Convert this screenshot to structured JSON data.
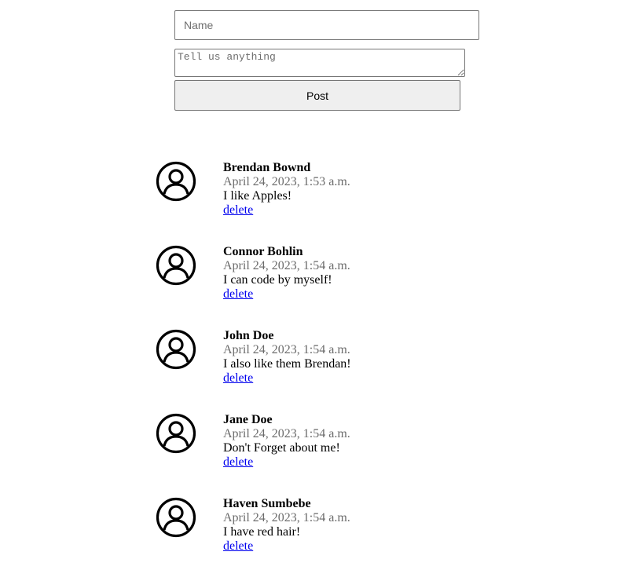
{
  "form": {
    "name_placeholder": "Name",
    "message_placeholder": "Tell us anything",
    "post_label": "Post"
  },
  "posts": [
    {
      "author": "Brendan Bownd",
      "date": "April 24, 2023, 1:53 a.m.",
      "message": "I like Apples!",
      "delete_label": "delete"
    },
    {
      "author": "Connor Bohlin",
      "date": "April 24, 2023, 1:54 a.m.",
      "message": "I can code by myself!",
      "delete_label": "delete"
    },
    {
      "author": "John Doe",
      "date": "April 24, 2023, 1:54 a.m.",
      "message": "I also like them Brendan!",
      "delete_label": "delete"
    },
    {
      "author": "Jane Doe",
      "date": "April 24, 2023, 1:54 a.m.",
      "message": "Don't Forget about me!",
      "delete_label": "delete"
    },
    {
      "author": "Haven Sumbebe",
      "date": "April 24, 2023, 1:54 a.m.",
      "message": "I have red hair!",
      "delete_label": "delete"
    }
  ],
  "icons": {
    "avatar": "user-circle-icon"
  }
}
